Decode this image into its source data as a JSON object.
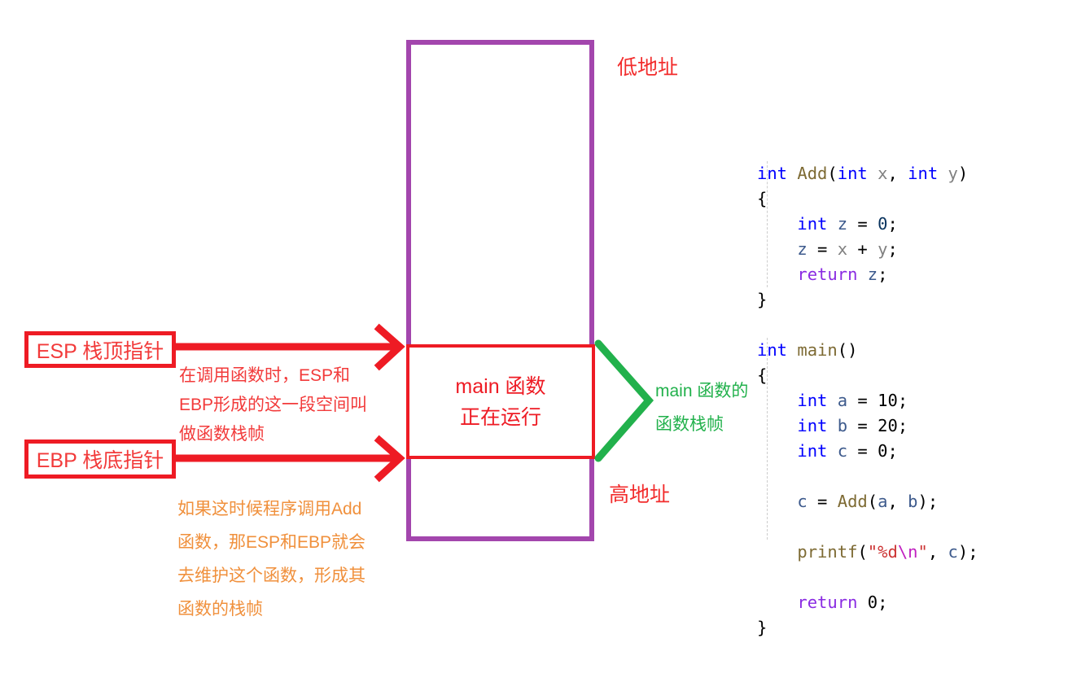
{
  "diagram": {
    "title": "function stack frame diagram",
    "stack_box": {
      "label": "stack-memory-region",
      "border_color": "#a346ad"
    },
    "main_frame": {
      "line1": "main 函数",
      "line2": "正在运行",
      "border_color": "#ee1b24",
      "text_color": "#ee1b24"
    },
    "address_labels": {
      "low": "低地址",
      "high": "高地址",
      "color": "#f22c2c"
    },
    "pointers": [
      {
        "name": "esp",
        "label": "ESP 栈顶指针",
        "color": "#ee1b24"
      },
      {
        "name": "ebp",
        "label": "EBP 栈底指针",
        "color": "#ee1b24"
      }
    ],
    "notes": {
      "red": {
        "color": "#f23a3a",
        "lines": [
          "在调用函数时，ESP和",
          "EBP形成的这一段空间叫",
          "做函数栈帧"
        ]
      },
      "orange": {
        "color": "#f0903c",
        "lines": [
          "如果这时候程序调用Add",
          "函数，那ESP和EBP就会",
          "去维护这个函数，形成其",
          "函数的栈帧"
        ]
      },
      "green": {
        "color": "#22b14c",
        "lines": [
          "main 函数的",
          "函数栈帧"
        ]
      }
    },
    "arrows": {
      "esp_arrow": {
        "color": "#ee1b24",
        "direction": "right"
      },
      "ebp_arrow": {
        "color": "#ee1b24",
        "direction": "right"
      },
      "green_bracket": {
        "color": "#22b14c",
        "shape": "angle-bracket-right"
      }
    }
  },
  "code": {
    "language": "c",
    "lines": [
      [
        {
          "t": "int",
          "c": "kw"
        },
        {
          "t": " ",
          "c": "plain"
        },
        {
          "t": "Add",
          "c": "fn"
        },
        {
          "t": "(",
          "c": "plain"
        },
        {
          "t": "int",
          "c": "kw"
        },
        {
          "t": " ",
          "c": "plain"
        },
        {
          "t": "x",
          "c": "par"
        },
        {
          "t": ", ",
          "c": "plain"
        },
        {
          "t": "int",
          "c": "kw"
        },
        {
          "t": " ",
          "c": "plain"
        },
        {
          "t": "y",
          "c": "par"
        },
        {
          "t": ")",
          "c": "plain"
        }
      ],
      [
        {
          "t": "{",
          "c": "plain"
        }
      ],
      [
        {
          "t": "    ",
          "c": "plain"
        },
        {
          "t": "int",
          "c": "kw"
        },
        {
          "t": " ",
          "c": "plain"
        },
        {
          "t": "z",
          "c": "var"
        },
        {
          "t": " = ",
          "c": "plain"
        },
        {
          "t": "0",
          "c": "num"
        },
        {
          "t": ";",
          "c": "plain"
        }
      ],
      [
        {
          "t": "    ",
          "c": "plain"
        },
        {
          "t": "z",
          "c": "var"
        },
        {
          "t": " = ",
          "c": "plain"
        },
        {
          "t": "x",
          "c": "par"
        },
        {
          "t": " + ",
          "c": "plain"
        },
        {
          "t": "y",
          "c": "par"
        },
        {
          "t": ";",
          "c": "plain"
        }
      ],
      [
        {
          "t": "    ",
          "c": "plain"
        },
        {
          "t": "return",
          "c": "kw2"
        },
        {
          "t": " ",
          "c": "plain"
        },
        {
          "t": "z",
          "c": "var"
        },
        {
          "t": ";",
          "c": "plain"
        }
      ],
      [
        {
          "t": "}",
          "c": "plain"
        }
      ],
      [
        {
          "t": " ",
          "c": "plain"
        }
      ],
      [
        {
          "t": "int",
          "c": "kw"
        },
        {
          "t": " ",
          "c": "plain"
        },
        {
          "t": "main",
          "c": "fn"
        },
        {
          "t": "()",
          "c": "plain"
        }
      ],
      [
        {
          "t": "{",
          "c": "plain"
        }
      ],
      [
        {
          "t": "    ",
          "c": "plain"
        },
        {
          "t": "int",
          "c": "kw"
        },
        {
          "t": " ",
          "c": "plain"
        },
        {
          "t": "a",
          "c": "var"
        },
        {
          "t": " = ",
          "c": "plain"
        },
        {
          "t": "10",
          "c": "num2"
        },
        {
          "t": ";",
          "c": "plain"
        }
      ],
      [
        {
          "t": "    ",
          "c": "plain"
        },
        {
          "t": "int",
          "c": "kw"
        },
        {
          "t": " ",
          "c": "plain"
        },
        {
          "t": "b",
          "c": "var"
        },
        {
          "t": " = ",
          "c": "plain"
        },
        {
          "t": "20",
          "c": "num2"
        },
        {
          "t": ";",
          "c": "plain"
        }
      ],
      [
        {
          "t": "    ",
          "c": "plain"
        },
        {
          "t": "int",
          "c": "kw"
        },
        {
          "t": " ",
          "c": "plain"
        },
        {
          "t": "c",
          "c": "var"
        },
        {
          "t": " = ",
          "c": "plain"
        },
        {
          "t": "0",
          "c": "num2"
        },
        {
          "t": ";",
          "c": "plain"
        }
      ],
      [
        {
          "t": " ",
          "c": "plain"
        }
      ],
      [
        {
          "t": "    ",
          "c": "plain"
        },
        {
          "t": "c",
          "c": "var"
        },
        {
          "t": " = ",
          "c": "plain"
        },
        {
          "t": "Add",
          "c": "fn"
        },
        {
          "t": "(",
          "c": "plain"
        },
        {
          "t": "a",
          "c": "var"
        },
        {
          "t": ", ",
          "c": "plain"
        },
        {
          "t": "b",
          "c": "var"
        },
        {
          "t": ");",
          "c": "plain"
        }
      ],
      [
        {
          "t": " ",
          "c": "plain"
        }
      ],
      [
        {
          "t": "    ",
          "c": "plain"
        },
        {
          "t": "printf",
          "c": "fn"
        },
        {
          "t": "(",
          "c": "plain"
        },
        {
          "t": "\"%d",
          "c": "str"
        },
        {
          "t": "\\n",
          "c": "esc"
        },
        {
          "t": "\"",
          "c": "str"
        },
        {
          "t": ", ",
          "c": "plain"
        },
        {
          "t": "c",
          "c": "var"
        },
        {
          "t": ");",
          "c": "plain"
        }
      ],
      [
        {
          "t": " ",
          "c": "plain"
        }
      ],
      [
        {
          "t": "    ",
          "c": "plain"
        },
        {
          "t": "return",
          "c": "kw2"
        },
        {
          "t": " ",
          "c": "plain"
        },
        {
          "t": "0",
          "c": "num2"
        },
        {
          "t": ";",
          "c": "plain"
        }
      ],
      [
        {
          "t": "}",
          "c": "plain"
        }
      ]
    ]
  }
}
